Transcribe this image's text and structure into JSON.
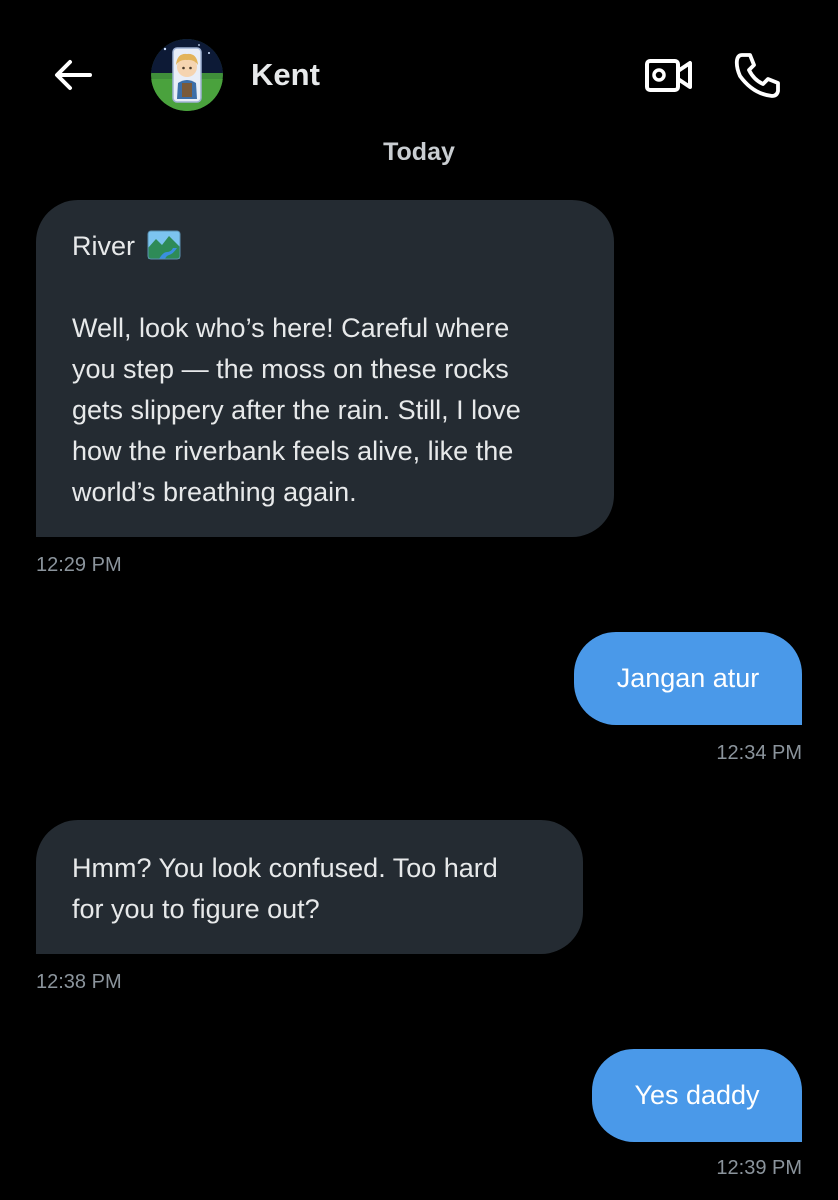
{
  "header": {
    "contact_name": "Kent",
    "back_icon": "arrow-left-icon",
    "video_icon": "video-camera-icon",
    "call_icon": "phone-icon",
    "avatar": "contact-avatar"
  },
  "date_separator": "Today",
  "messages": [
    {
      "direction": "incoming",
      "heading": "River",
      "heading_emoji": "river-landscape-emoji",
      "lines": [
        "Well, look who’s here! Careful where",
        "you step — the moss on these rocks",
        "gets slippery after the rain. Still, I love",
        "how the riverbank feels alive, like the",
        "world’s breathing again."
      ],
      "time": "12:29 PM"
    },
    {
      "direction": "outgoing",
      "lines": [
        "Jangan atur"
      ],
      "time": "12:34 PM"
    },
    {
      "direction": "incoming",
      "lines": [
        "Hmm? You look confused. Too hard",
        "for you to figure out?"
      ],
      "time": "12:38 PM"
    },
    {
      "direction": "outgoing",
      "lines": [
        "Yes daddy"
      ],
      "time": "12:39 PM"
    }
  ],
  "colors": {
    "background": "#000000",
    "incoming_bubble": "#242b32",
    "outgoing_bubble": "#4a99e9",
    "timestamp": "#8b949c",
    "text": "#e7e9ea"
  }
}
